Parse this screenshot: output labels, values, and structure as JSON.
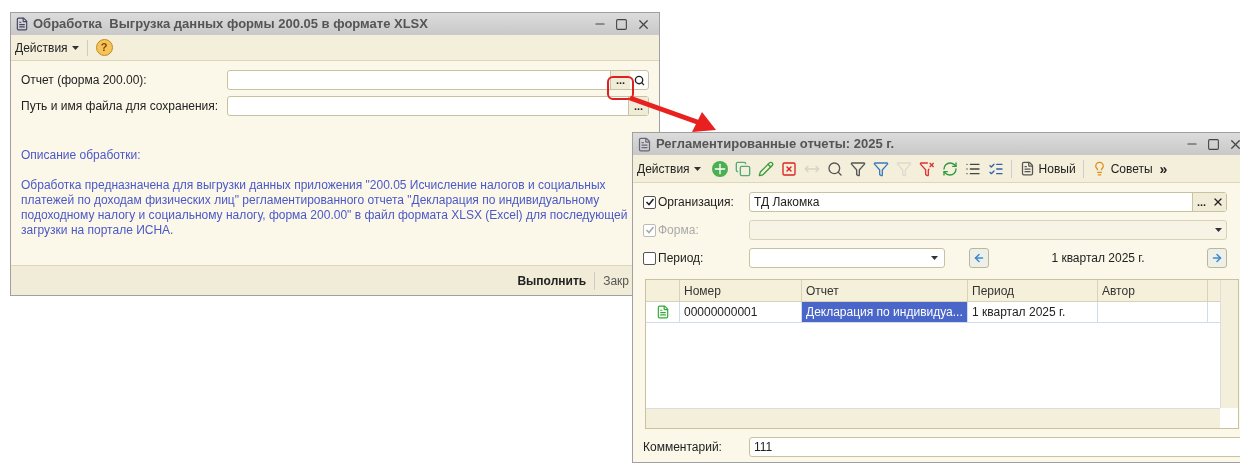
{
  "processing_window": {
    "title": "Обработка  Выгрузка данных формы 200.05 в формате XLSX",
    "toolbar": {
      "menu": "Действия",
      "help": "?"
    },
    "fields": [
      {
        "label": "Отчет (форма 200.00):",
        "choose": "...",
        "search": true
      },
      {
        "label": "Путь и имя файла для сохранения:",
        "choose": "...",
        "search": false
      }
    ],
    "description_title": "Описание обработки:",
    "description": "Обработка предназначена для выгрузки данных приложения \"200.05 Исчисление налогов и социальных платежей по доходам физических лиц\" регламентированного отчета \"Декларация по индивидуальному подоходному налогу и социальному налогу, форма 200.00\" в файл формата XLSX (Excel) для последующей загрузки на портале ИСНА.",
    "buttons": [
      {
        "label": "Выполнить",
        "default": true
      },
      {
        "label": "Закр",
        "default": false
      }
    ]
  },
  "reports_window": {
    "title": "Регламентированные отчеты: 2025 г.",
    "toolbar": [
      {
        "kind": "menu",
        "label": "Действия"
      },
      {
        "kind": "icon",
        "disabled": false
      },
      {
        "kind": "icon",
        "disabled": false
      },
      {
        "kind": "icon",
        "disabled": false
      },
      {
        "kind": "icon",
        "disabled": false
      },
      {
        "kind": "icon",
        "disabled": true
      },
      {
        "kind": "icon",
        "disabled": false
      },
      {
        "kind": "icon",
        "disabled": false
      },
      {
        "kind": "icon",
        "disabled": false
      },
      {
        "kind": "icon",
        "disabled": true
      },
      {
        "kind": "icon",
        "disabled": false
      },
      {
        "kind": "icon",
        "disabled": false
      },
      {
        "kind": "icon",
        "disabled": false
      },
      {
        "kind": "icon",
        "disabled": false
      },
      {
        "kind": "button",
        "label": "Новый"
      },
      {
        "kind": "button",
        "label": "Советы"
      },
      {
        "kind": "overflow",
        "label": "»"
      }
    ],
    "filters": [
      {
        "kind": "choice",
        "label": "Организация:",
        "checked": true,
        "disabled": false,
        "value": "ТД Лакомка",
        "choose": "..."
      },
      {
        "kind": "dropdown",
        "label": "Форма:",
        "checked": true,
        "disabled": true
      },
      {
        "kind": "period",
        "label": "Период:",
        "checked": false,
        "disabled": false,
        "period": "1 квартал 2025 г."
      }
    ],
    "table": {
      "columns": [
        "Номер",
        "Отчет",
        "Период",
        "Автор"
      ],
      "rows": [
        {
          "cells": [
            {
              "text": "00000000001",
              "selected": false
            },
            {
              "text": "Декларация по индивидуа...",
              "selected": true
            },
            {
              "text": "1 квартал 2025 г.",
              "selected": false
            },
            {
              "text": "",
              "selected": false
            }
          ]
        }
      ]
    },
    "comment": {
      "label": "Комментарий:",
      "value": "111"
    }
  }
}
